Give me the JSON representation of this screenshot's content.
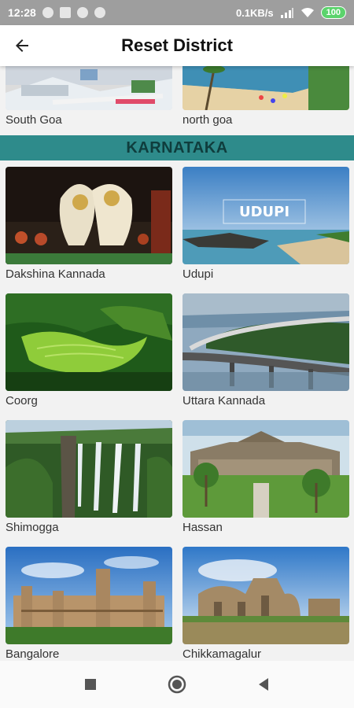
{
  "status_bar": {
    "time": "12:28",
    "network_speed": "0.1KB/s",
    "battery": "100"
  },
  "app_bar": {
    "title": "Reset District"
  },
  "top_partial": {
    "items": [
      {
        "label": "South Goa"
      },
      {
        "label": "north goa"
      }
    ]
  },
  "section": {
    "title": "KARNATAKA"
  },
  "districts": [
    {
      "label": "Dakshina Kannada"
    },
    {
      "label": "Udupi",
      "overlay_text": "UDUPI"
    },
    {
      "label": "Coorg"
    },
    {
      "label": "Uttara Kannada"
    },
    {
      "label": "Shimogga"
    },
    {
      "label": "Hassan"
    },
    {
      "label": "Bangalore"
    },
    {
      "label": "Chikkamagalur"
    }
  ],
  "colors": {
    "section_bg": "#2e8b8b",
    "section_text": "#0f3d3d",
    "status_bar": "#9e9e9e"
  },
  "icons": {
    "back": "arrow-left-icon",
    "nav_recent": "square-icon",
    "nav_home": "circle-icon",
    "nav_back": "triangle-left-icon"
  }
}
